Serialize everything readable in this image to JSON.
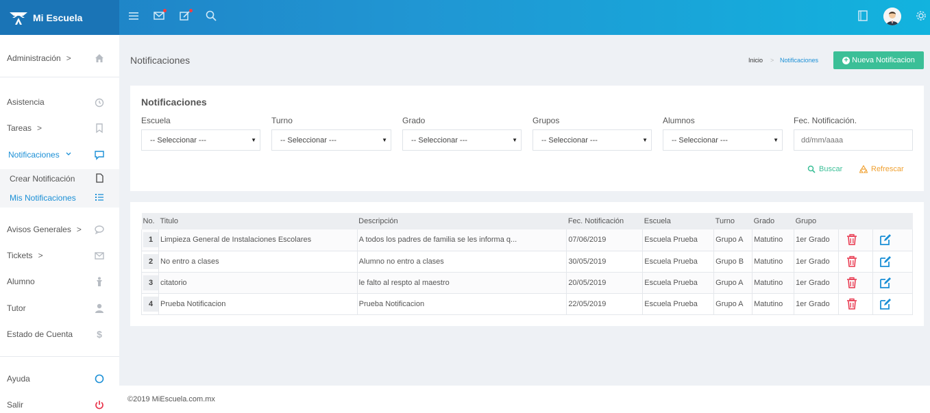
{
  "app": {
    "title": "Mi Escuela"
  },
  "sidebar": {
    "items": [
      {
        "label": "Administración",
        "chevron": ">",
        "icon": "home-icon"
      },
      {
        "label": "Asistencia",
        "icon": "clock-icon"
      },
      {
        "label": "Tareas",
        "chevron": ">",
        "icon": "bookmark-icon"
      },
      {
        "label": "Notificaciones",
        "chevron": "v",
        "icon": "chat-icon"
      },
      {
        "label": "Crear Notificación",
        "icon": "file-icon"
      },
      {
        "label": "Mis Notificaciones",
        "icon": "list-icon"
      },
      {
        "label": "Avisos Generales",
        "chevron": ">",
        "icon": "comment-icon"
      },
      {
        "label": "Tickets",
        "chevron": ">",
        "icon": "mail-icon"
      },
      {
        "label": "Alumno",
        "icon": "student-icon"
      },
      {
        "label": "Tutor",
        "icon": "user-icon"
      },
      {
        "label": "Estado de Cuenta",
        "icon": "dollar-icon"
      },
      {
        "label": "Ayuda",
        "icon": "help-circle-icon"
      },
      {
        "label": "Salir",
        "icon": "power-icon"
      }
    ]
  },
  "header": {
    "page_title": "Notificaciones",
    "breadcrumb": {
      "home": "Inicio",
      "separator": ">",
      "current": "Notificaciones"
    },
    "new_button": "Nueva Notificacion"
  },
  "filters": {
    "title": "Notificaciones",
    "escuela": {
      "label": "Escuela",
      "value": "-- Seleccionar ---"
    },
    "turno": {
      "label": "Turno",
      "value": "-- Seleccionar ---"
    },
    "grado": {
      "label": "Grado",
      "value": "-- Seleccionar ---"
    },
    "grupos": {
      "label": "Grupos",
      "value": "-- Seleccionar ---"
    },
    "alumnos": {
      "label": "Alumnos",
      "value": "-- Seleccionar ---"
    },
    "fecha": {
      "label": "Fec. Notificación.",
      "placeholder": "dd/mm/aaaa"
    },
    "buscar": "Buscar",
    "refrescar": "Refrescar"
  },
  "table": {
    "columns": [
      "No.",
      "Titulo",
      "Descripción",
      "Fec. Notificación",
      "Escuela",
      "Turno",
      "Grado",
      "Grupo"
    ],
    "rows": [
      {
        "no": "1",
        "titulo": "Limpieza General de Instalaciones Escolares",
        "descripcion": "A todos los padres de familia se les informa q...",
        "fecha": "07/06/2019",
        "escuela": "Escuela Prueba",
        "turno": "Grupo A",
        "grado": "Matutino",
        "grupo": "1er Grado"
      },
      {
        "no": "2",
        "titulo": "No entro a clases",
        "descripcion": "Alumno no entro a clases",
        "fecha": "30/05/2019",
        "escuela": "Escuela Prueba",
        "turno": "Grupo B",
        "grado": "Matutino",
        "grupo": "1er Grado"
      },
      {
        "no": "3",
        "titulo": "citatorio",
        "descripcion": "le falto al respto al maestro",
        "fecha": "20/05/2019",
        "escuela": "Escuela Prueba",
        "turno": "Grupo A",
        "grado": "Matutino",
        "grupo": "1er Grado"
      },
      {
        "no": "4",
        "titulo": "Prueba Notificacion",
        "descripcion": "Prueba Notificacion",
        "fecha": "22/05/2019",
        "escuela": "Escuela Prueba",
        "turno": "Grupo A",
        "grado": "Matutino",
        "grupo": "1er Grado"
      }
    ]
  },
  "footer": {
    "copyright": "©2019 MiEscuela.com.mx"
  },
  "colors": {
    "accent": "#1a8fd6",
    "success": "#3bbf97",
    "danger": "#e8334a",
    "warning": "#f0a030",
    "edit": "#1a8fd6"
  }
}
